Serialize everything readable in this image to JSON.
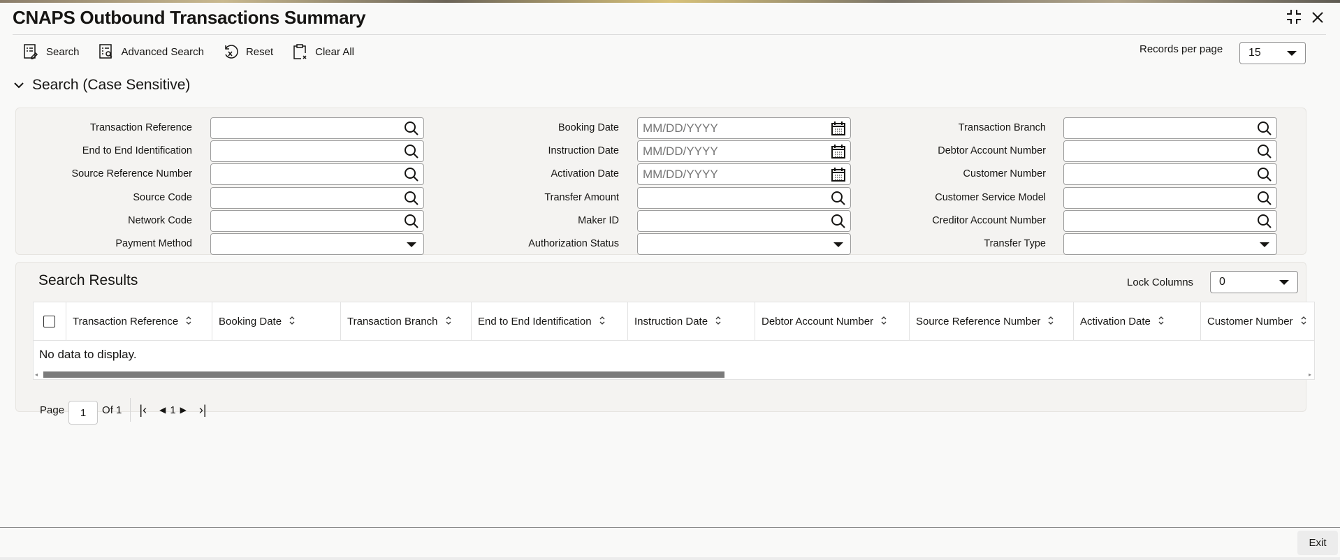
{
  "header": {
    "title": "CNAPS Outbound Transactions Summary"
  },
  "toolbar": {
    "search": "Search",
    "advanced_search": "Advanced Search",
    "reset": "Reset",
    "clear_all": "Clear All",
    "records_per_page_label": "Records per page",
    "records_per_page_value": "15"
  },
  "search_section": {
    "title": "Search (Case Sensitive)"
  },
  "fields": {
    "col1": [
      {
        "label": "Transaction Reference",
        "type": "lookup",
        "value": ""
      },
      {
        "label": "End to End Identification",
        "type": "lookup",
        "value": ""
      },
      {
        "label": "Source Reference Number",
        "type": "lookup",
        "value": ""
      },
      {
        "label": "Source Code",
        "type": "lookup",
        "value": ""
      },
      {
        "label": "Network Code",
        "type": "lookup",
        "value": ""
      },
      {
        "label": "Payment Method",
        "type": "select",
        "value": ""
      }
    ],
    "col2": [
      {
        "label": "Booking Date",
        "type": "date",
        "placeholder": "MM/DD/YYYY"
      },
      {
        "label": "Instruction Date",
        "type": "date",
        "placeholder": "MM/DD/YYYY"
      },
      {
        "label": "Activation Date",
        "type": "date",
        "placeholder": "MM/DD/YYYY"
      },
      {
        "label": "Transfer Amount",
        "type": "lookup",
        "value": ""
      },
      {
        "label": "Maker ID",
        "type": "lookup",
        "value": ""
      },
      {
        "label": "Authorization Status",
        "type": "select",
        "value": ""
      }
    ],
    "col3": [
      {
        "label": "Transaction Branch",
        "type": "lookup",
        "value": ""
      },
      {
        "label": "Debtor Account Number",
        "type": "lookup",
        "value": ""
      },
      {
        "label": "Customer Number",
        "type": "lookup",
        "value": ""
      },
      {
        "label": "Customer Service Model",
        "type": "lookup",
        "value": ""
      },
      {
        "label": "Creditor Account Number",
        "type": "lookup",
        "value": ""
      },
      {
        "label": "Transfer Type",
        "type": "select",
        "value": ""
      }
    ]
  },
  "results": {
    "title": "Search Results",
    "lock_columns_label": "Lock Columns",
    "lock_columns_value": "0",
    "columns": [
      "Transaction Reference",
      "Booking Date",
      "Transaction Branch",
      "End to End Identification",
      "Instruction Date",
      "Debtor Account Number",
      "Source Reference Number",
      "Activation Date",
      "Customer Number"
    ],
    "empty_text": "No data to display.",
    "pagination": {
      "page_label": "Page",
      "page_value": "1",
      "of_label": "Of 1",
      "current": "1"
    }
  },
  "footer": {
    "exit": "Exit"
  }
}
